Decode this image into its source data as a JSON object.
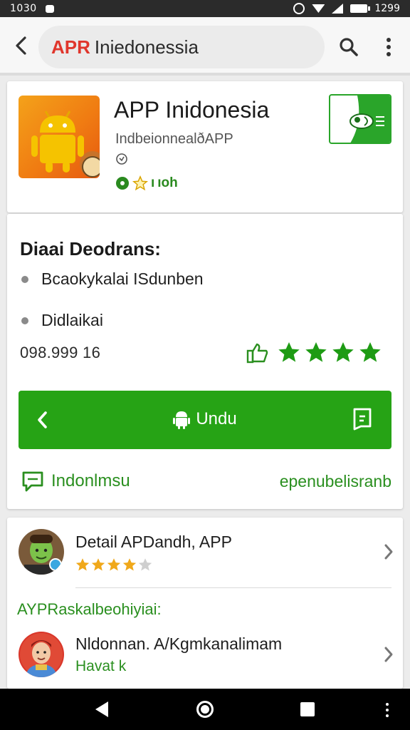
{
  "status_bar": {
    "time_left": "1030",
    "time_right": "1299"
  },
  "app_bar": {
    "search_accent": "APR",
    "search_text": "Iniedonessia"
  },
  "app": {
    "title": "APP Inidonesia",
    "subtitle": "IndbeionnealðAPP",
    "rating_text": "ıoh",
    "rating_prefix": "ı"
  },
  "details": {
    "title": "Diaai Deodrans:",
    "bullets": [
      "Bcaokykalai ISdunben",
      "Didlaikai"
    ],
    "count": "098.999  16",
    "stars": 4,
    "cta_label": "Undu",
    "footer_left": "Indonlmsu",
    "footer_right": "epenubelisranb"
  },
  "list": {
    "item1": {
      "title": "Detail APDandh, APP",
      "stars": 4
    },
    "section_label": "AYPRaskalbeohiyiai:",
    "item2": {
      "title": "Nldonnan. A/Kgmkanalimam",
      "subtitle": "Havat k"
    }
  },
  "colors": {
    "accent_green": "#26a315",
    "accent_red": "#e0362c",
    "text_green": "#2a8f1f"
  }
}
